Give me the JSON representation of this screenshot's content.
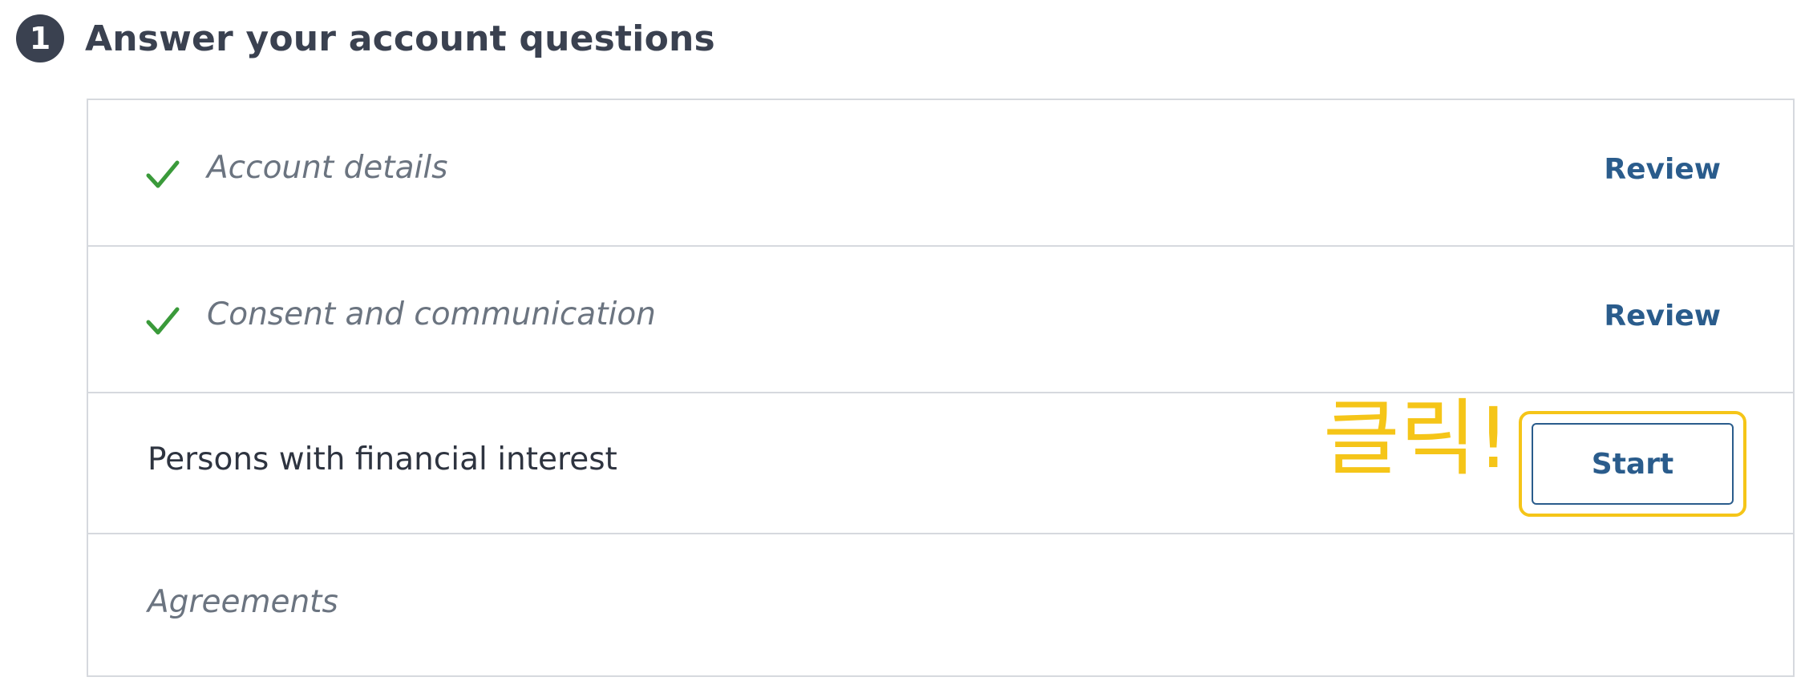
{
  "step": {
    "number": "1",
    "title": "Answer your account questions"
  },
  "rows": [
    {
      "label": "Account details",
      "status": "complete",
      "action": "Review",
      "icon": "check-icon"
    },
    {
      "label": "Consent and communication",
      "status": "complete",
      "action": "Review",
      "icon": "check-icon"
    },
    {
      "label": "Persons with financial interest",
      "status": "current",
      "action": "Start"
    }
  ],
  "locked_row": {
    "label": "Agreements"
  },
  "annotation": {
    "text": "클릭!",
    "color": "#f5c518"
  },
  "colors": {
    "accent": "#2a5c8c",
    "check": "#3a9a3a",
    "highlight": "#f5c518",
    "step_circle": "#3a4150"
  }
}
